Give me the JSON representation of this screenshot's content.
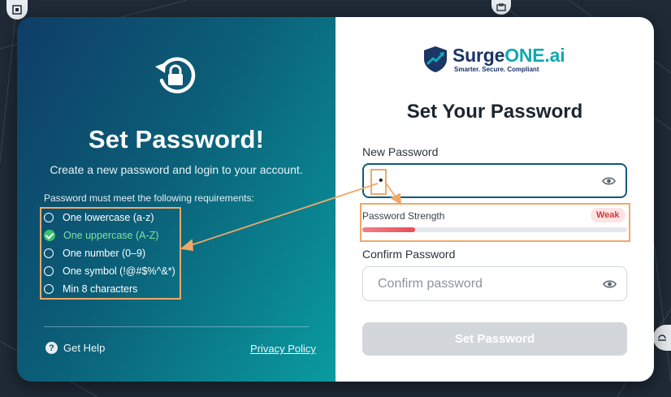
{
  "left": {
    "title": "Set Password!",
    "subtitle": "Create a new password and login to your account.",
    "requirements_heading": "Password must meet the following requirements:",
    "requirements": [
      {
        "label": "One lowercase (a-z)",
        "met": false
      },
      {
        "label": "One uppercase (A-Z)",
        "met": true
      },
      {
        "label": "One number (0–9)",
        "met": false
      },
      {
        "label": "One symbol (!@#$%^&*)",
        "met": false
      },
      {
        "label": "Min 8 characters",
        "met": false
      }
    ],
    "help_label": "Get Help",
    "privacy_label": "Privacy Policy"
  },
  "right": {
    "logo": {
      "brand_prefix": "Surge",
      "brand_suffix": "ONE.ai",
      "tagline": "Smarter. Secure. Compliant"
    },
    "title": "Set Your Password",
    "new_password": {
      "label": "New Password",
      "value": "•"
    },
    "strength": {
      "label": "Password Strength",
      "badge": "Weak",
      "level": 0.2
    },
    "confirm_password": {
      "label": "Confirm Password",
      "placeholder": "Confirm password"
    },
    "submit_label": "Set Password"
  },
  "colors": {
    "brand_navy": "#1a3566",
    "brand_teal": "#12a8b3",
    "weak_red": "#e94e5a",
    "annotation_orange": "#f0a868",
    "requirement_met": "#36c46a"
  },
  "icons": {
    "reset": "lock-refresh-icon",
    "eye": "eye-icon",
    "help": "question-circle-icon",
    "logo": "shield-chart-icon"
  }
}
